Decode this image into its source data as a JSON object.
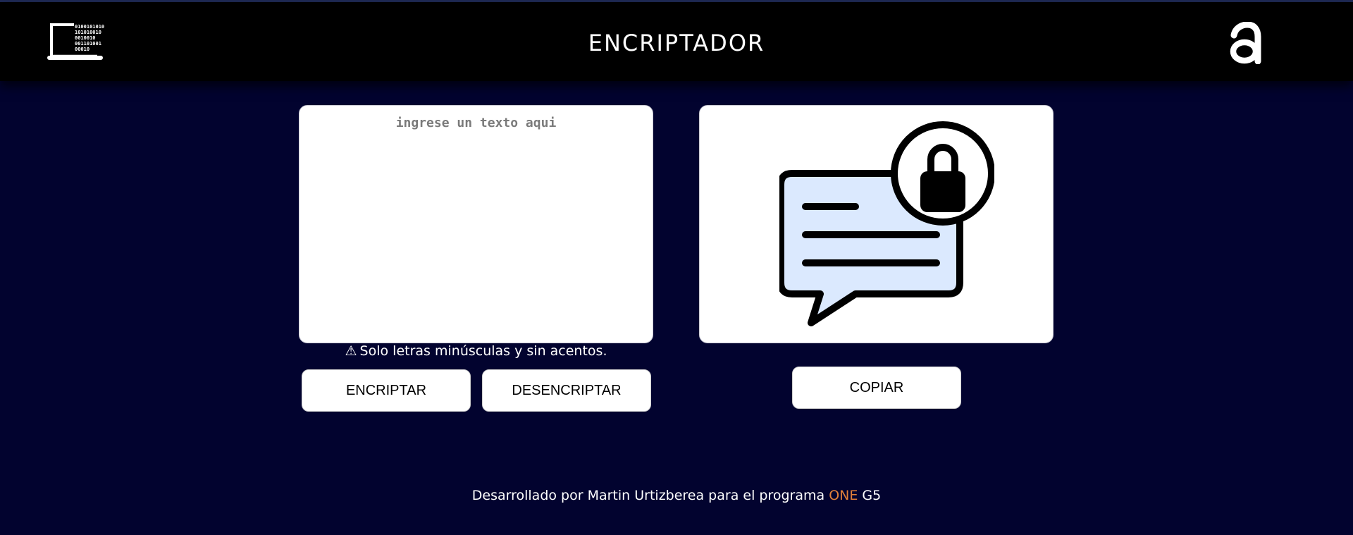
{
  "header": {
    "title": "ENCRIPTADOR",
    "logo_left_icon": "laptop-binary-icon",
    "binary_lines": [
      "0100101010",
      "101010010",
      "0010010",
      "001101001",
      "00010"
    ],
    "logo_right_icon": "alura-a-icon"
  },
  "input": {
    "placeholder": "ingrese un texto aqui",
    "value": ""
  },
  "warning": {
    "icon": "⚠",
    "text": "Solo letras minúsculas y sin acentos."
  },
  "buttons": {
    "encrypt": "ENCRIPTAR",
    "decrypt": "DESENCRIPTAR",
    "copy": "COPIAR"
  },
  "output": {
    "illustration_icon": "locked-message-icon"
  },
  "footer": {
    "prefix": "Desarrollado por Martin Urtizberea para el programa",
    "highlight": "ONE",
    "suffix": "G5"
  },
  "colors": {
    "background": "#02032f",
    "header": "#000000",
    "accent": "#e2803a",
    "bubble_fill": "#dbe9fe"
  }
}
